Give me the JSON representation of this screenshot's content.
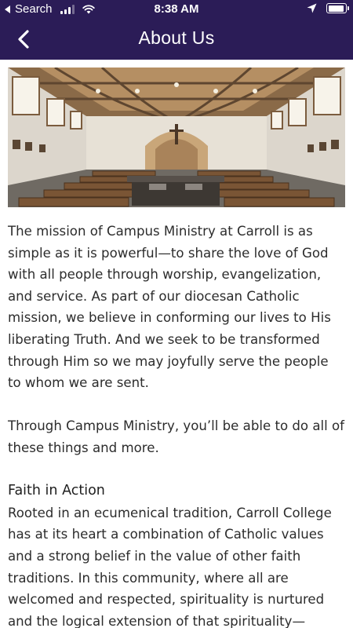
{
  "status_bar": {
    "back_app": "Search",
    "time": "8:38 AM",
    "icons": [
      "signal-icon",
      "wifi-icon",
      "location-arrow-icon",
      "battery-icon"
    ]
  },
  "nav": {
    "title": "About Us",
    "back_icon": "chevron-left-icon"
  },
  "colors": {
    "header_bg": "#2b1c57",
    "header_text": "#ffffff",
    "body_text": "#2c2c2c"
  },
  "hero_image": {
    "subject": "chapel interior photo"
  },
  "content": {
    "mission_paragraph": "The mission of Campus Ministry at Carroll is as simple as it is powerful—to share the love of God with all people through worship, evangelization, and service. As part of our diocesan Catholic mission, we believe in conforming our lives to His liberating Truth. And we seek to be transformed through Him so we may joyfully serve the people to whom we are sent.",
    "campus_ministry_paragraph": "Through Campus Ministry, you’ll be able to do all of these things and more.",
    "faith_heading": "Faith in Action",
    "faith_paragraph": "Rooted in an ecumenical tradition, Carroll College has at its heart a combination of Catholic values and a strong belief in the value of other faith traditions. In this community, where all are welcomed and respected, spirituality is nurtured and the logical extension of that spirituality—"
  }
}
